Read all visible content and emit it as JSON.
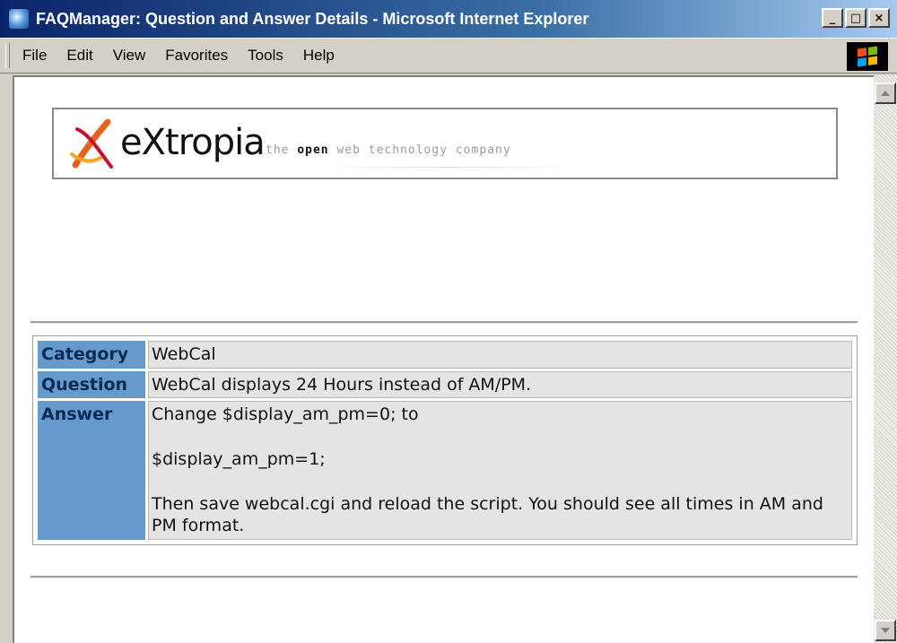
{
  "window": {
    "title": "FAQManager: Question and Answer Details - Microsoft Internet Explorer",
    "buttons": {
      "minimize": "_",
      "maximize": "□",
      "close": "×"
    }
  },
  "menu": {
    "items": [
      "File",
      "Edit",
      "View",
      "Favorites",
      "Tools",
      "Help"
    ]
  },
  "banner": {
    "logo_text": "eXtropia",
    "tagline_pre": "the",
    "tagline_bold": "open",
    "tagline_post": "web technology company"
  },
  "faq": {
    "category_label": "Category",
    "category_value": "WebCal",
    "question_label": "Question",
    "question_value": "WebCal displays 24 Hours instead of AM/PM.",
    "answer_label": "Answer",
    "answer_lines": [
      "Change $display_am_pm=0; to",
      "$display_am_pm=1;",
      "Then save webcal.cgi and reload the script. You should see all times in AM and PM format."
    ]
  },
  "colors": {
    "label_bg": "#6699cc",
    "value_bg": "#e4e4e4",
    "titlebar_start": "#0a246a"
  }
}
